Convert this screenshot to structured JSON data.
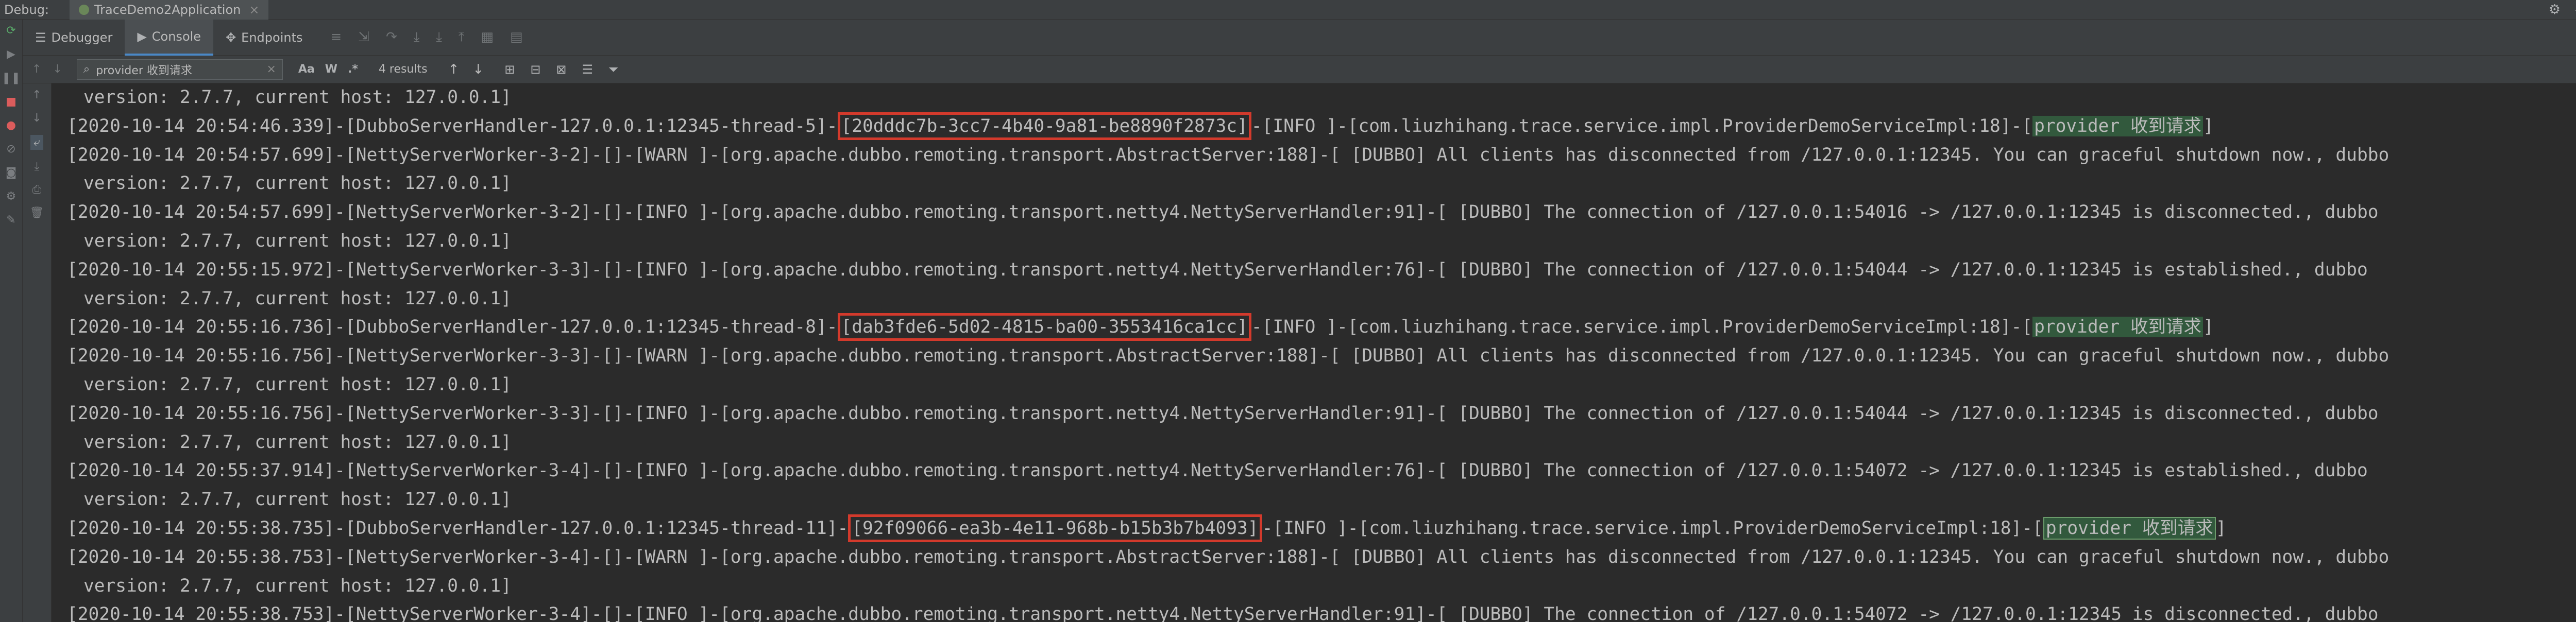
{
  "title_bar": {
    "label": "Debug:",
    "tab": "TraceDemo2Application",
    "close": "×",
    "gear": "⚙",
    "minimize": "—"
  },
  "tabs": [
    {
      "icon": "☰",
      "label": "Debugger"
    },
    {
      "icon": "▶",
      "label": "Console"
    },
    {
      "icon": "✥",
      "label": "Endpoints"
    }
  ],
  "search": {
    "value": "provider 收到请求",
    "match_case": "Aa",
    "words": "W",
    "regex": ".*",
    "results": "4 results"
  },
  "console": {
    "lines": [
      {
        "cont": true,
        "text": "version: 2.7.7, current host: 127.0.0.1]"
      },
      {
        "pre": "[2020-10-14 20:54:46.339]-[DubboServerHandler-127.0.0.1:12345-thread-5]-",
        "trace": "[20dddc7b-3cc7-4b40-9a81-be8890f2873c]",
        "post": "-[INFO ]-[com.liuzhihang.trace.service.impl.ProviderDemoServiceImpl:18]-[",
        "hit": "provider 收到请求",
        "tail": "]"
      },
      {
        "text": "[2020-10-14 20:54:57.699]-[NettyServerWorker-3-2]-[]-[WARN ]-[org.apache.dubbo.remoting.transport.AbstractServer:188]-[ [DUBBO] All clients has disconnected from /127.0.0.1:12345. You can graceful shutdown now., dubbo"
      },
      {
        "cont": true,
        "text": "version: 2.7.7, current host: 127.0.0.1]"
      },
      {
        "text": "[2020-10-14 20:54:57.699]-[NettyServerWorker-3-2]-[]-[INFO ]-[org.apache.dubbo.remoting.transport.netty4.NettyServerHandler:91]-[ [DUBBO] The connection of /127.0.0.1:54016 -> /127.0.0.1:12345 is disconnected., dubbo"
      },
      {
        "cont": true,
        "text": "version: 2.7.7, current host: 127.0.0.1]"
      },
      {
        "text": "[2020-10-14 20:55:15.972]-[NettyServerWorker-3-3]-[]-[INFO ]-[org.apache.dubbo.remoting.transport.netty4.NettyServerHandler:76]-[ [DUBBO] The connection of /127.0.0.1:54044 -> /127.0.0.1:12345 is established., dubbo"
      },
      {
        "cont": true,
        "text": "version: 2.7.7, current host: 127.0.0.1]"
      },
      {
        "pre": "[2020-10-14 20:55:16.736]-[DubboServerHandler-127.0.0.1:12345-thread-8]-",
        "trace": "[dab3fde6-5d02-4815-ba00-3553416ca1cc]",
        "post": "-[INFO ]-[com.liuzhihang.trace.service.impl.ProviderDemoServiceImpl:18]-[",
        "hit": "provider 收到请求",
        "tail": "]"
      },
      {
        "text": "[2020-10-14 20:55:16.756]-[NettyServerWorker-3-3]-[]-[WARN ]-[org.apache.dubbo.remoting.transport.AbstractServer:188]-[ [DUBBO] All clients has disconnected from /127.0.0.1:12345. You can graceful shutdown now., dubbo"
      },
      {
        "cont": true,
        "text": "version: 2.7.7, current host: 127.0.0.1]"
      },
      {
        "text": "[2020-10-14 20:55:16.756]-[NettyServerWorker-3-3]-[]-[INFO ]-[org.apache.dubbo.remoting.transport.netty4.NettyServerHandler:91]-[ [DUBBO] The connection of /127.0.0.1:54044 -> /127.0.0.1:12345 is disconnected., dubbo"
      },
      {
        "cont": true,
        "text": "version: 2.7.7, current host: 127.0.0.1]"
      },
      {
        "text": "[2020-10-14 20:55:37.914]-[NettyServerWorker-3-4]-[]-[INFO ]-[org.apache.dubbo.remoting.transport.netty4.NettyServerHandler:76]-[ [DUBBO] The connection of /127.0.0.1:54072 -> /127.0.0.1:12345 is established., dubbo"
      },
      {
        "cont": true,
        "text": "version: 2.7.7, current host: 127.0.0.1]"
      },
      {
        "pre": "[2020-10-14 20:55:38.735]-[DubboServerHandler-127.0.0.1:12345-thread-11]-",
        "trace": "[92f09066-ea3b-4e11-968b-b15b3b7b4093]",
        "post": "-[INFO ]-[com.liuzhihang.trace.service.impl.ProviderDemoServiceImpl:18]-[",
        "hit": "provider 收到请求",
        "tail": "]",
        "current": true
      },
      {
        "text": "[2020-10-14 20:55:38.753]-[NettyServerWorker-3-4]-[]-[WARN ]-[org.apache.dubbo.remoting.transport.AbstractServer:188]-[ [DUBBO] All clients has disconnected from /127.0.0.1:12345. You can graceful shutdown now., dubbo"
      },
      {
        "cont": true,
        "text": "version: 2.7.7, current host: 127.0.0.1]"
      },
      {
        "text": "[2020-10-14 20:55:38.753]-[NettyServerWorker-3-4]-[]-[INFO ]-[org.apache.dubbo.remoting.transport.netty4.NettyServerHandler:91]-[ [DUBBO] The connection of /127.0.0.1:54072 -> /127.0.0.1:12345 is disconnected., dubbo"
      }
    ]
  },
  "colors": {
    "trace_box": "#d33a2c",
    "search_hit_bg": "#32593d",
    "background": "#2b2b2b",
    "text": "#bbbbbb"
  }
}
